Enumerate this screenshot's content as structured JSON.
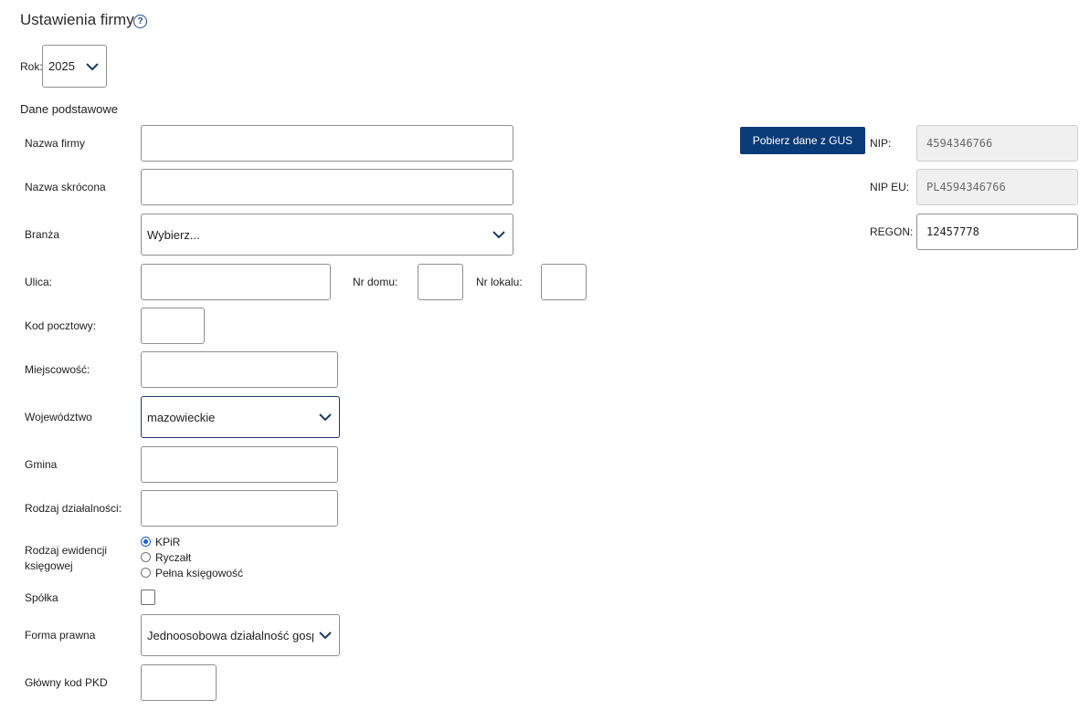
{
  "page": {
    "title": "Ustawienia firmy",
    "help_icon": "?"
  },
  "year": {
    "label": "Rok:",
    "value": "2025"
  },
  "section_basic": "Dane podstawowe",
  "fields": {
    "company_name": {
      "label": "Nazwa firmy",
      "value": ""
    },
    "short_name": {
      "label": "Nazwa skrócona",
      "value": ""
    },
    "industry": {
      "label": "Branża",
      "value": "Wybierz..."
    },
    "street": {
      "label": "Ulica:",
      "value": ""
    },
    "house_no": {
      "label": "Nr domu:",
      "value": ""
    },
    "apt_no": {
      "label": "Nr lokalu:",
      "value": ""
    },
    "postal_code": {
      "label": "Kod pocztowy:",
      "value": ""
    },
    "city": {
      "label": "Miejscowość:",
      "value": ""
    },
    "voivodeship": {
      "label": "Województwo",
      "value": "mazowieckie"
    },
    "commune": {
      "label": "Gmina",
      "value": ""
    },
    "activity_type": {
      "label": "Rodzaj działalności:",
      "value": ""
    },
    "accounting": {
      "label": "Rodzaj ewidencji księgowej",
      "options": [
        "KPiR",
        "Ryczałt",
        "Pełna księgowość"
      ],
      "selected": "KPiR"
    },
    "partnership": {
      "label": "Spółka",
      "checked": false
    },
    "legal_form": {
      "label": "Forma prawna",
      "value": "Jednoosobowa działalność gosp"
    },
    "pkd": {
      "label": "Główny kod PKD",
      "value": ""
    }
  },
  "gus_button": "Pobierz dane z GUS",
  "right": {
    "nip": {
      "label": "NIP:",
      "value": "4594346766"
    },
    "nip_eu": {
      "label": "NIP EU:",
      "value": "PL4594346766"
    },
    "regon": {
      "label": "REGON:",
      "value": "12457778"
    }
  },
  "colors": {
    "accent": "#0b3a78",
    "radio": "#1a5fd0"
  }
}
